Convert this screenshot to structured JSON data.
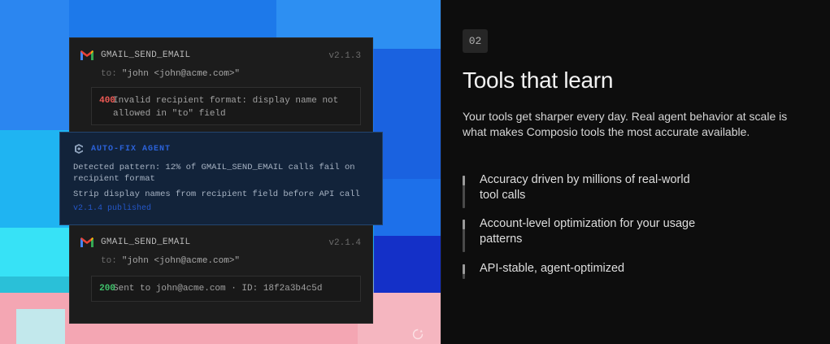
{
  "cards": {
    "top": {
      "tool_name": "GMAIL_SEND_EMAIL",
      "version": "v2.1.3",
      "to_label": "to:",
      "to_value": "\"john <john@acme.com>\"",
      "code": "400",
      "message": "Invalid recipient format: display name not allowed in \"to\" field"
    },
    "agent": {
      "name": "AUTO-FIX AGENT",
      "line1": "Detected pattern: 12% of GMAIL_SEND_EMAIL calls fail on recipient format",
      "line2": "Strip display names from recipient field before API call",
      "published": "v2.1.4 published"
    },
    "bottom": {
      "tool_name": "GMAIL_SEND_EMAIL",
      "version": "v2.1.4",
      "to_label": "to:",
      "to_value": "\"john <john@acme.com>\"",
      "code": "200",
      "message": "Sent to john@acme.com · ID: 18f2a3b4c5d"
    }
  },
  "section": {
    "step": "02",
    "title": "Tools that learn",
    "description": "Your tools get sharper every day. Real agent behavior at scale is what makes Composio tools the most accurate available.",
    "features": [
      "Accuracy driven by millions of real-world tool calls",
      "Account-level optimization for your usage patterns",
      "API-stable, agent-optimized"
    ]
  },
  "colors": {
    "error_code": "#ef5a55",
    "success_code": "#3fc06a",
    "agent_accent": "#2b62d9"
  },
  "icons": [
    "gmail-icon",
    "composio-agent-icon",
    "refresh-icon"
  ]
}
